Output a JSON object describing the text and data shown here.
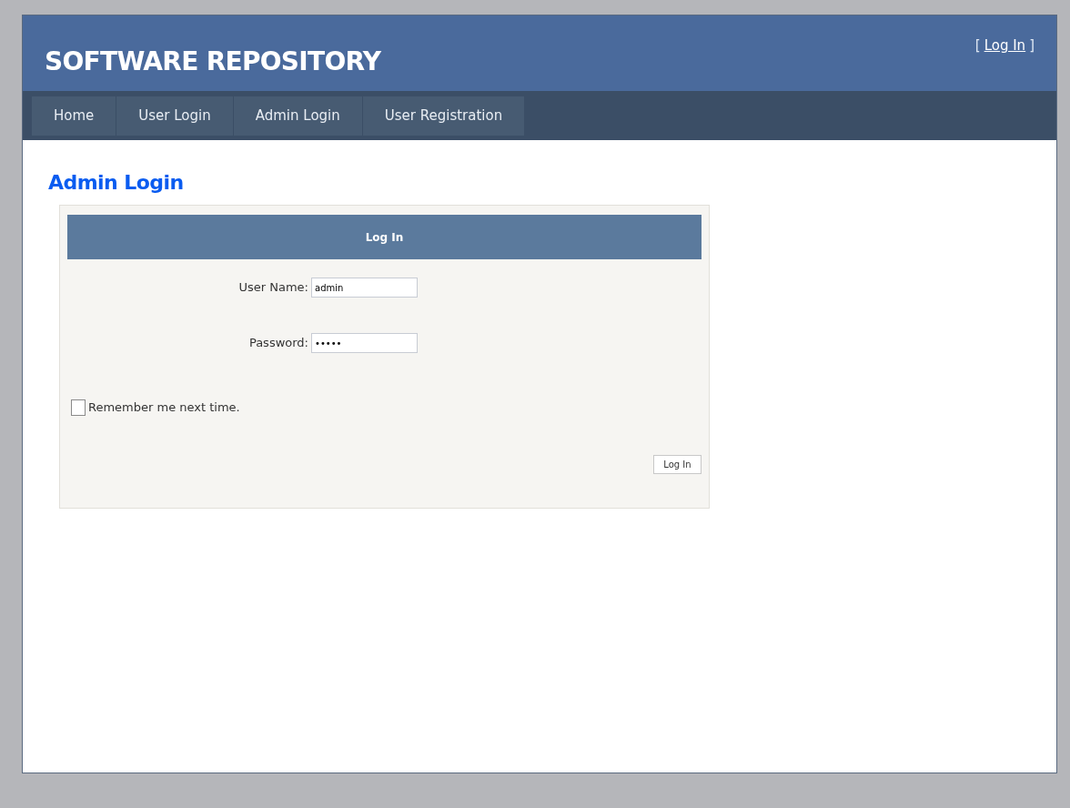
{
  "header": {
    "title": "SOFTWARE REPOSITORY",
    "login_link": {
      "open_bracket": "[",
      "label": "Log In",
      "close_bracket": "]"
    }
  },
  "nav": [
    {
      "label": "Home"
    },
    {
      "label": "User Login"
    },
    {
      "label": "Admin Login"
    },
    {
      "label": "User Registration"
    }
  ],
  "page_title": "Admin Login",
  "login_box": {
    "title": "Log In",
    "fields": [
      {
        "label": "User Name:",
        "value": "admin"
      },
      {
        "label": "Password:",
        "value": "•••••"
      }
    ],
    "remember": {
      "label": "Remember me next time.",
      "checked": false
    },
    "button": "Log In"
  }
}
